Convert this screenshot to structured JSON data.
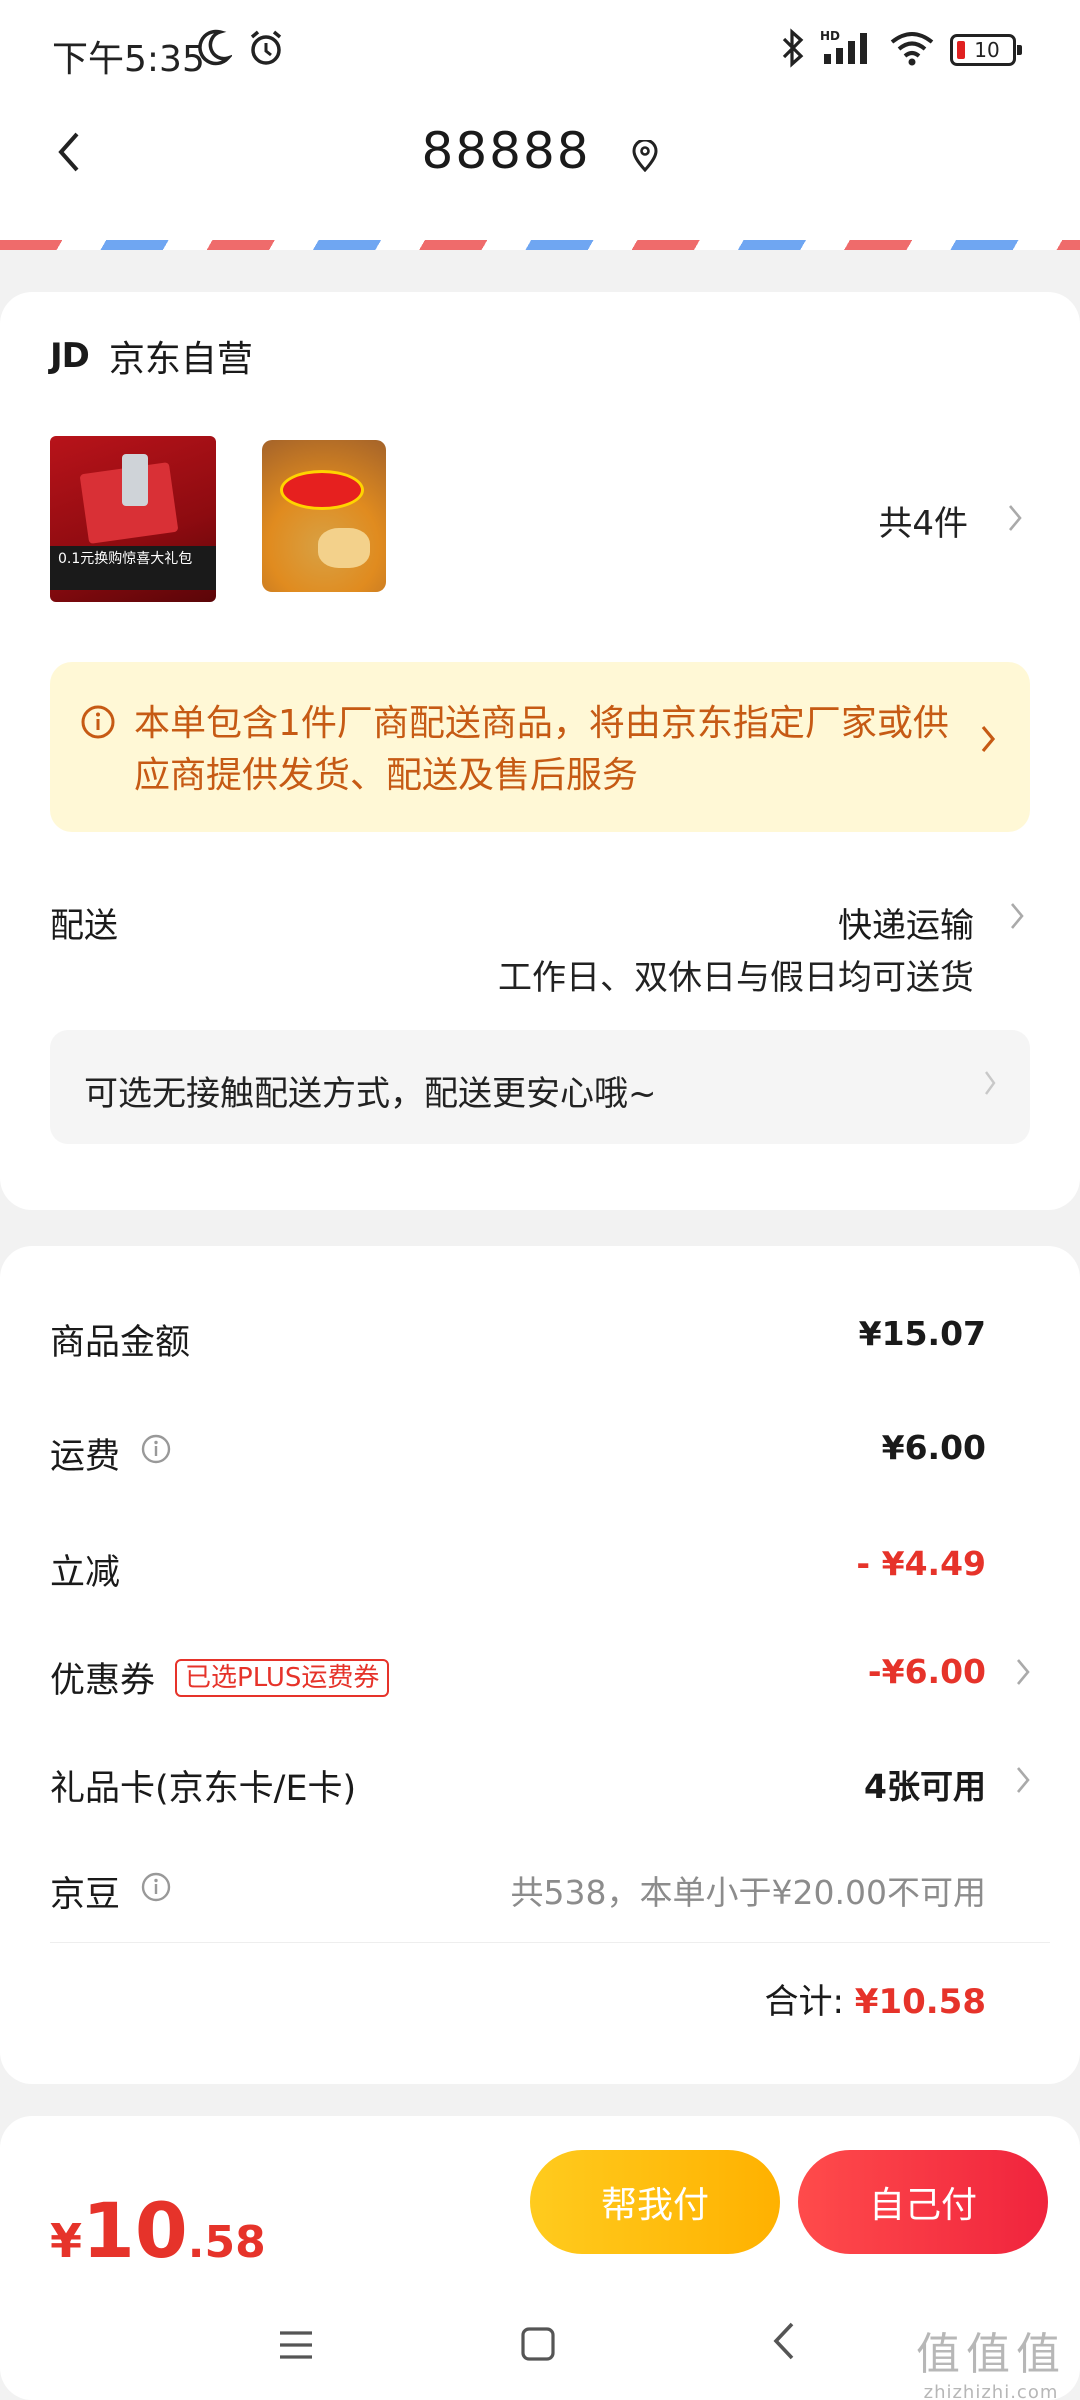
{
  "status_bar": {
    "time": "下午5:35",
    "battery": "10",
    "network": "HD",
    "icons": [
      "moon-icon",
      "alarm-icon",
      "bluetooth-icon",
      "signal-icon",
      "wifi-icon",
      "battery-icon"
    ]
  },
  "header": {
    "address": "88888",
    "back_icon": "chevron-left-icon",
    "location_icon": "location-pin-icon"
  },
  "store": {
    "logo": "JD",
    "name": "京东自营",
    "product_images": [
      {
        "label": "0.1元换购惊喜大礼包"
      },
      {
        "label": "lay's乐事"
      }
    ],
    "item_count": "共4件"
  },
  "notice": {
    "text": "本单包含1件厂商配送商品，将由京东指定厂家或供应商提供发货、配送及售后服务"
  },
  "delivery": {
    "label": "配送",
    "method": "快递运输",
    "note": "工作日、双休日与假日均可送货",
    "contactless": "可选无接触配送方式，配送更安心哦~"
  },
  "fees": {
    "goods": {
      "label": "商品金额",
      "value": "¥15.07"
    },
    "shipping": {
      "label": "运费",
      "value": "¥6.00"
    },
    "discount": {
      "label": "立减",
      "value": "- ¥4.49"
    },
    "coupon": {
      "label": "优惠券",
      "tag": "已选PLUS运费券",
      "value": "-¥6.00"
    },
    "giftcard": {
      "label": "礼品卡(京东卡/E卡)",
      "value": "4张可用"
    },
    "jingdou": {
      "label": "京豆",
      "value": "共538，本单小于¥20.00不可用"
    },
    "total_label": "合计:",
    "total_value": "¥10.58"
  },
  "bottom_bar": {
    "price_yen": "¥",
    "price_int": "10",
    "price_dec": ".58",
    "help_pay": "帮我付",
    "self_pay": "自己付"
  },
  "watermark": {
    "line1": "值值值",
    "line2": "zhizhizhi.com"
  },
  "colors": {
    "accent_red": "#e6332a",
    "notice_bg": "#fff8d6",
    "notice_text": "#c65a14",
    "help_btn": "#ffb100",
    "self_btn": "#f0243d"
  }
}
